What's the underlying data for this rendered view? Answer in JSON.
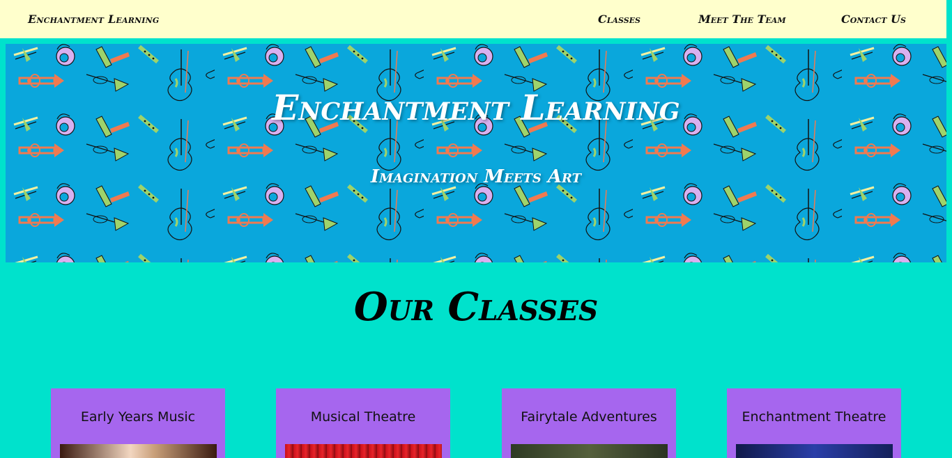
{
  "nav": {
    "brand": "Enchantment Learning",
    "links": [
      {
        "label": "Classes"
      },
      {
        "label": "Meet The Team"
      },
      {
        "label": "Contact Us"
      }
    ]
  },
  "hero": {
    "title": "Enchantment Learning",
    "subtitle": "Imagination Meets Art"
  },
  "classes": {
    "heading": "Our Classes",
    "cards": [
      {
        "title": "Early Years Music"
      },
      {
        "title": "Musical Theatre"
      },
      {
        "title": "Fairytale Adventures"
      },
      {
        "title": "Enchantment Theatre"
      }
    ]
  },
  "colors": {
    "page_bg": "#00e2cc",
    "nav_bg": "#ffffcc",
    "hero_bg": "#0aa7dc",
    "card_bg": "#a666ee"
  },
  "icons": [
    "trumpet-icon",
    "trombone-icon",
    "violin-icon",
    "french-horn-icon",
    "clarinet-icon",
    "harmonica-icon"
  ]
}
